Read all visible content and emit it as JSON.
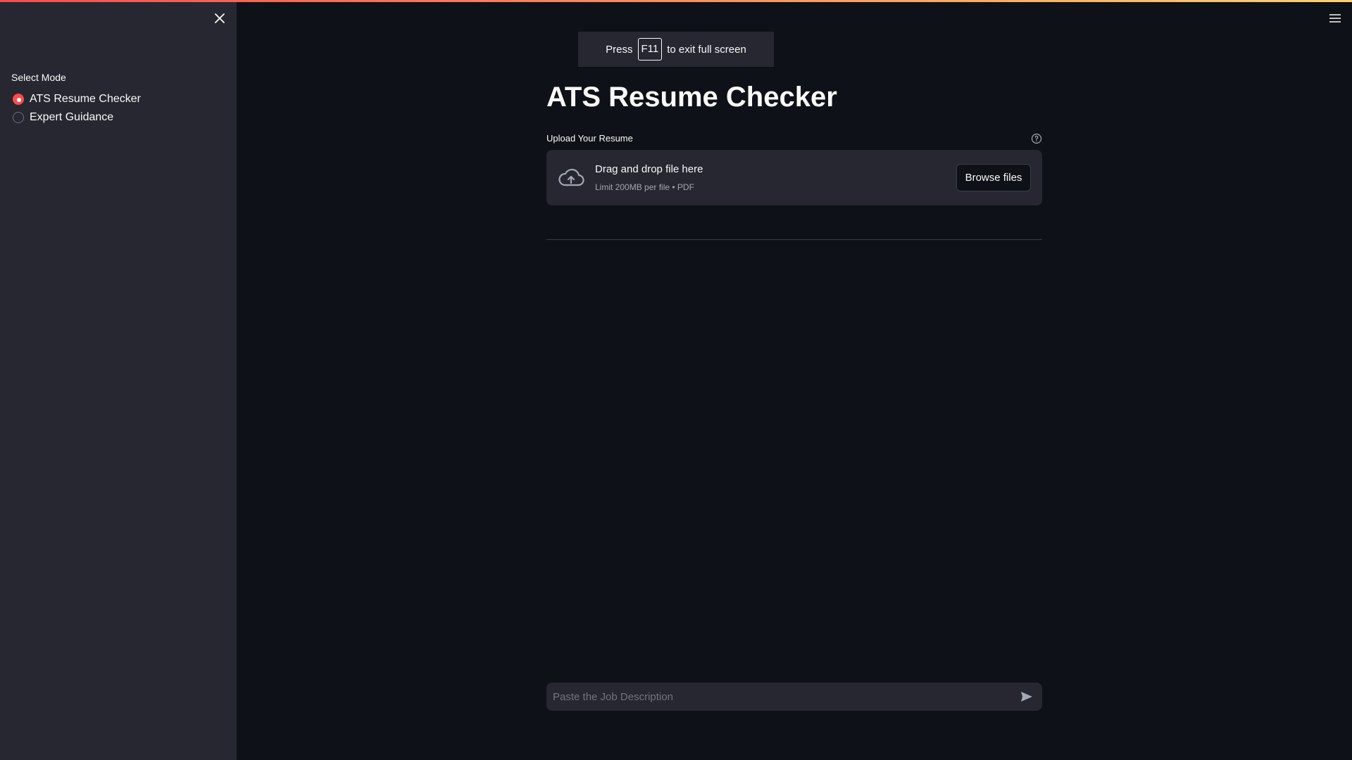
{
  "sidebar": {
    "close_icon": "close-icon",
    "mode_label": "Select Mode",
    "modes": [
      {
        "label": "ATS Resume Checker",
        "checked": true
      },
      {
        "label": "Expert Guidance",
        "checked": false
      }
    ]
  },
  "header": {
    "menu_icon": "hamburger-menu-icon"
  },
  "fullscreen_toast": {
    "prefix": "Press",
    "key": "F11",
    "suffix": "to exit full screen"
  },
  "main": {
    "title": "ATS Resume Checker",
    "upload": {
      "label": "Upload Your Resume",
      "help_icon": "help-circle-icon",
      "drop_title": "Drag and drop file here",
      "limit_text": "Limit 200MB per file • PDF",
      "browse_label": "Browse files",
      "cloud_icon": "cloud-upload-icon"
    },
    "chat": {
      "placeholder": "Paste the Job Description",
      "send_icon": "send-icon"
    }
  },
  "colors": {
    "background": "#0e1117",
    "sidebar": "#262730",
    "accent": "#ff4b4b",
    "text": "#fafafa",
    "muted": "#a3a8b4"
  }
}
